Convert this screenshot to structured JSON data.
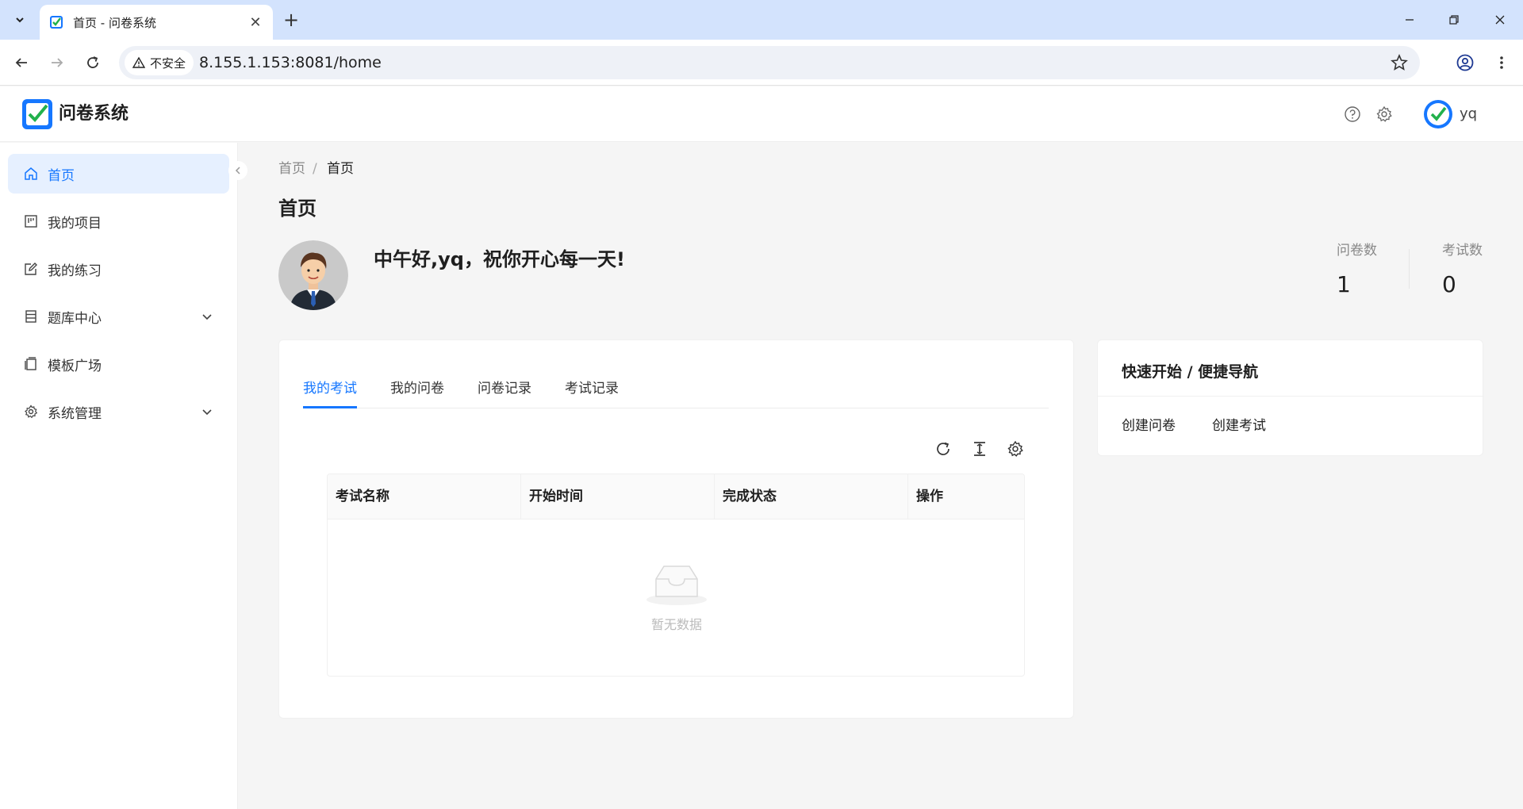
{
  "browser": {
    "tab_title": "首页 - 问卷系统",
    "security_label": "不安全",
    "url": "8.155.1.153:8081/home"
  },
  "app": {
    "title": "问卷系统",
    "user_name": "yq"
  },
  "sidebar": {
    "items": [
      {
        "label": "首页",
        "icon": "home-icon",
        "active": true
      },
      {
        "label": "我的项目",
        "icon": "project-icon"
      },
      {
        "label": "我的练习",
        "icon": "edit-icon"
      },
      {
        "label": "题库中心",
        "icon": "database-icon",
        "expandable": true
      },
      {
        "label": "模板广场",
        "icon": "template-icon"
      },
      {
        "label": "系统管理",
        "icon": "gear-icon",
        "expandable": true
      }
    ]
  },
  "breadcrumb": [
    "首页",
    "首页"
  ],
  "page_title": "首页",
  "greeting": "中午好,yq，祝你开心每一天!",
  "stats": [
    {
      "label": "问卷数",
      "value": "1"
    },
    {
      "label": "考试数",
      "value": "0"
    }
  ],
  "tabs": [
    "我的考试",
    "我的问卷",
    "问卷记录",
    "考试记录"
  ],
  "table": {
    "columns": [
      "考试名称",
      "开始时间",
      "完成状态",
      "操作"
    ],
    "empty_text": "暂无数据"
  },
  "quick": {
    "title": "快速开始 / 便捷导航",
    "links": [
      "创建问卷",
      "创建考试"
    ]
  },
  "colors": {
    "primary": "#1677ff",
    "active_bg": "#e6f0ff",
    "tabstrip": "#d3e3fd"
  }
}
